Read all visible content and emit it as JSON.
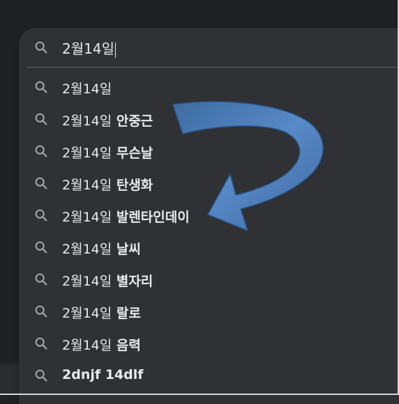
{
  "search": {
    "value": "2월14일",
    "placeholder": ""
  },
  "suggestions": [
    {
      "base": "2월14일",
      "completion": ""
    },
    {
      "base": "2월14일",
      "completion": " 안중근"
    },
    {
      "base": "2월14일",
      "completion": " 무슨날"
    },
    {
      "base": "2월14일",
      "completion": " 탄생화"
    },
    {
      "base": "2월14일",
      "completion": " 발렌타인데이"
    },
    {
      "base": "2월14일",
      "completion": " 날씨"
    },
    {
      "base": "2월14일",
      "completion": " 별자리"
    },
    {
      "base": "2월14일",
      "completion": " 랄로"
    },
    {
      "base": "2월14일",
      "completion": " 음력"
    },
    {
      "base": "",
      "completion": "2dnjf 14dlf"
    }
  ],
  "icons": {
    "search": "search-icon"
  },
  "colors": {
    "background": "#202124",
    "panel": "#303134",
    "text": "#e8eaed",
    "icon": "#9aa0a6",
    "arrow_fill": "#4a7fc1",
    "arrow_stroke": "#2b5a93"
  }
}
